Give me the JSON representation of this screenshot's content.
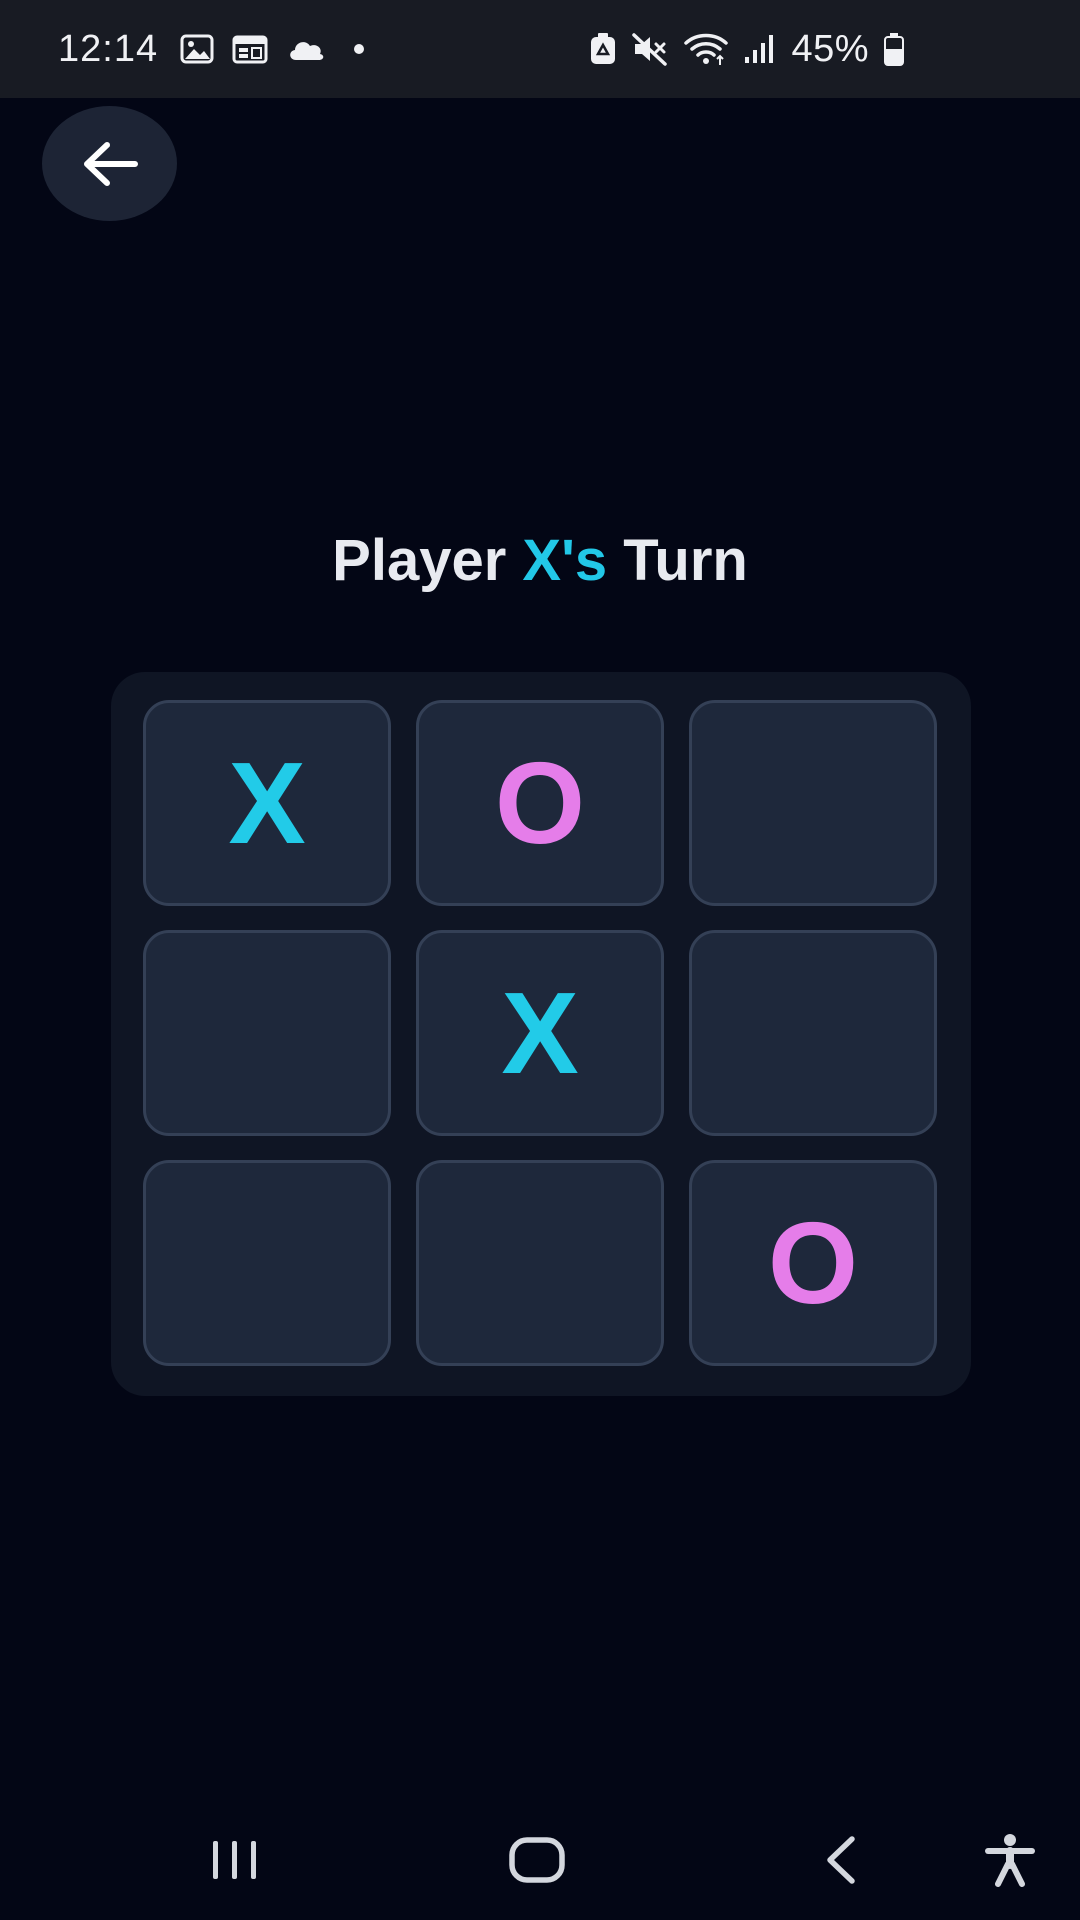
{
  "status_bar": {
    "time": "12:14",
    "battery_text": "45%",
    "icons_left": [
      "gallery-icon",
      "calendar-icon",
      "cloud-icon",
      "notification-dot-icon"
    ],
    "icons_right": [
      "battery-saver-icon",
      "mute-icon",
      "wifi-icon",
      "signal-icon",
      "battery-icon"
    ]
  },
  "header": {
    "back_icon": "arrow-left-icon"
  },
  "game": {
    "title_prefix": "Player ",
    "current_player": "X's",
    "title_suffix": " Turn",
    "board": [
      [
        "X",
        "O",
        ""
      ],
      [
        "",
        "X",
        ""
      ],
      [
        "",
        "",
        "O"
      ]
    ]
  },
  "nav_bar": {
    "icons": [
      "recent-apps-icon",
      "home-icon",
      "back-icon",
      "accessibility-icon"
    ]
  },
  "colors": {
    "background": "#030615",
    "x_mark": "#22cbe8",
    "o_mark": "#e57de9",
    "cell": "#1e283b",
    "board": "#0f1524"
  }
}
